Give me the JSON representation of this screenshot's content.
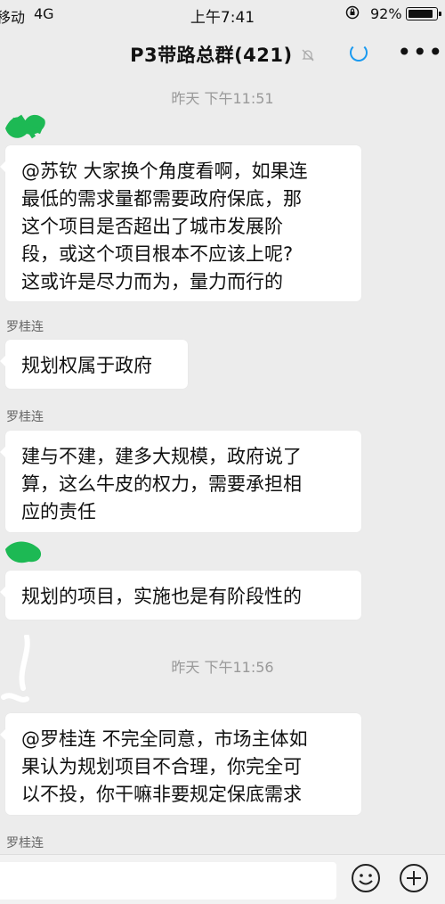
{
  "status_bar": {
    "carrier": "移动",
    "network": "4G",
    "time": "上午7:41",
    "battery_percent": "92%",
    "battery_level": 0.92
  },
  "nav": {
    "title": "P3带路总群(421)",
    "mute_icon": "bell-off-icon",
    "loading_icon": "loading-ring-icon",
    "more_icon": "more-dots-icon"
  },
  "messages": [
    {
      "type": "timestamp",
      "text": "昨天 下午11:51"
    },
    {
      "type": "message",
      "sender": "",
      "lines": [
        "@苏钦 大家换个角度看啊，如果连",
        "最低的需求量都需要政府保底，那",
        "这个项目是否超出了城市发展阶",
        "段，或这个项目根本不应该上呢?",
        "这或许是尽力而为，量力而行的"
      ]
    },
    {
      "type": "message",
      "sender": "罗桂连",
      "lines": [
        "规划权属于政府"
      ]
    },
    {
      "type": "message",
      "sender": "罗桂连",
      "lines": [
        "建与不建，建多大规模，政府说了",
        "算，这么牛皮的权力，需要承担相",
        "应的责任"
      ]
    },
    {
      "type": "message",
      "sender": "",
      "lines": [
        "规划的项目，实施也是有阶段性的"
      ]
    },
    {
      "type": "timestamp",
      "text": "昨天 下午11:56"
    },
    {
      "type": "message",
      "sender": "",
      "lines": [
        "@罗桂连 不完全同意，市场主体如",
        "果认为规划项目不合理，你完全可",
        "以不投，你干嘛非要规定保底需求"
      ]
    },
    {
      "type": "message",
      "sender": "罗桂连",
      "lines": []
    }
  ],
  "input_bar": {
    "emoji_icon": "emoji-icon",
    "plus_icon": "plus-circle-icon"
  },
  "colors": {
    "background": "#ececec",
    "bubble": "#ffffff",
    "accent": "#1a9af0",
    "scribble": "#1db954"
  }
}
